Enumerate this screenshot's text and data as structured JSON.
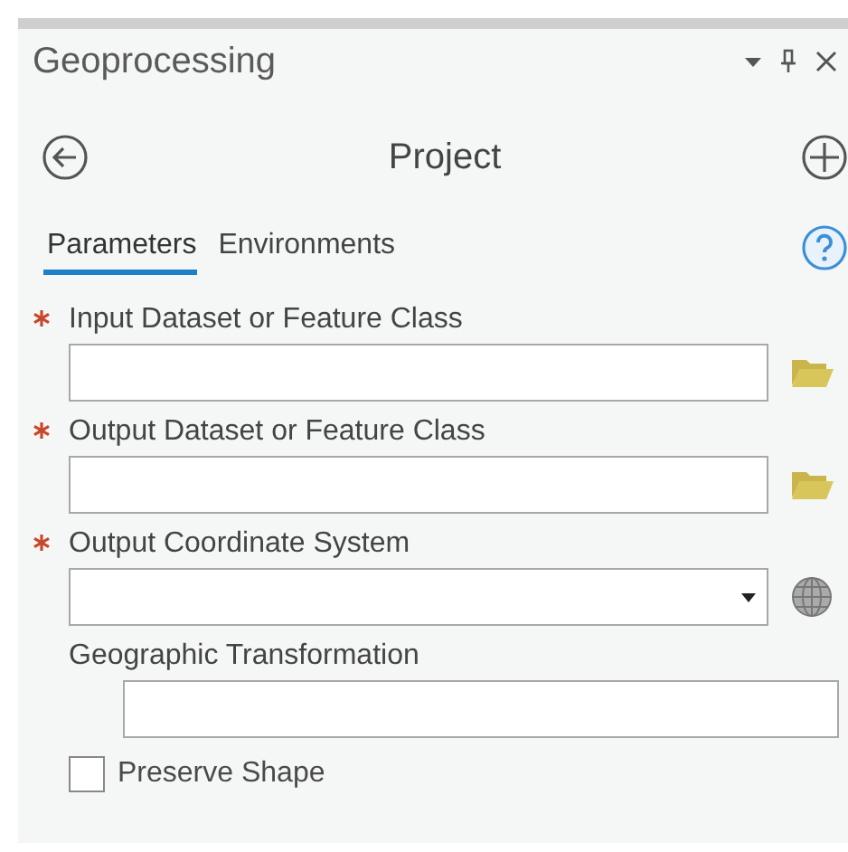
{
  "pane": {
    "title": "Geoprocessing"
  },
  "tool": {
    "name": "Project"
  },
  "tabs": [
    {
      "label": "Parameters",
      "selected": true
    },
    {
      "label": "Environments",
      "selected": false
    }
  ],
  "parameters": [
    {
      "kind": "dataset",
      "label": "Input Dataset or Feature Class",
      "required": true
    },
    {
      "kind": "dataset",
      "label": "Output Dataset or Feature Class",
      "required": true
    },
    {
      "kind": "coordinate",
      "label": "Output Coordinate System",
      "required": true
    },
    {
      "kind": "text",
      "label": "Geographic Transformation",
      "required": false
    },
    {
      "kind": "checkbox",
      "label": "Preserve Shape",
      "checked": false
    }
  ]
}
